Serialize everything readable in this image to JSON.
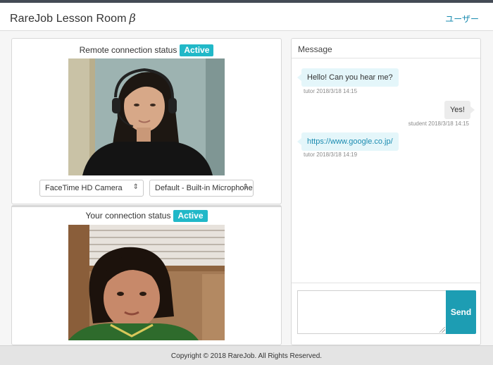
{
  "header": {
    "brand": "RareJob Lesson Room",
    "beta": "β",
    "user_link": "ユーザー"
  },
  "remote": {
    "status_label": "Remote connection status",
    "status_badge": "Active",
    "camera_select": "FaceTime HD Camera",
    "mic_select": "Default - Built-in Microphone"
  },
  "local": {
    "status_label": "Your connection status",
    "status_badge": "Active"
  },
  "messages": {
    "header": "Message",
    "items": [
      {
        "from": "tutor",
        "text": "Hello! Can you hear me?",
        "meta": "tutor 2018/3/18 14:15"
      },
      {
        "from": "student",
        "text": "Yes!",
        "meta": "student 2018/3/18 14:15"
      },
      {
        "from": "tutor",
        "text": "https://www.google.co.jp/",
        "meta": "tutor 2018/3/18 14:19"
      }
    ],
    "input_value": "",
    "send_label": "Send"
  },
  "footer": {
    "copyright": "Copyright © 2018 RareJob. All Rights Reserved."
  },
  "colors": {
    "accent": "#21b8c8",
    "send": "#1d9db3",
    "link": "#1a8bb0",
    "topbar_stripe": "#444b55"
  }
}
